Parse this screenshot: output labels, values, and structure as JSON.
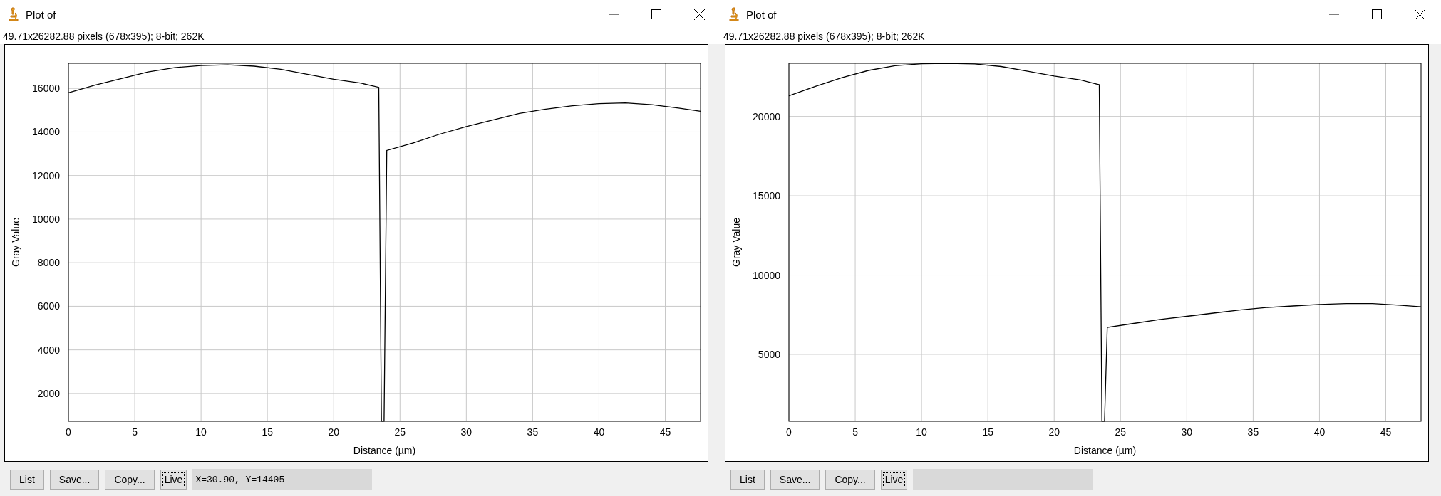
{
  "windows": [
    {
      "title": "Plot of",
      "subtitle": "49.71x26282.88 pixels (678x395); 8-bit; 262K",
      "chart_data": {
        "type": "line",
        "xlabel": "Distance (µm)",
        "ylabel": "Gray Value",
        "x": [
          0,
          2,
          4,
          6,
          8,
          10,
          12,
          14,
          16,
          18,
          20,
          22,
          23.4,
          23.6,
          23.8,
          24,
          26,
          28,
          30,
          32,
          34,
          36,
          38,
          40,
          42,
          44,
          46,
          47.66
        ],
        "series": [
          {
            "color": "#000000",
            "values": [
              15800,
              16150,
              16450,
              16750,
              16950,
              17050,
              17080,
              17020,
              16880,
              16650,
              16420,
              16250,
              16050,
              730,
              730,
              13150,
              13500,
              13900,
              14250,
              14550,
              14850,
              15050,
              15200,
              15300,
              15330,
              15250,
              15100,
              14950
            ]
          }
        ],
        "grid": true,
        "xlim": [
          0,
          47.66
        ],
        "ylim": [
          723,
          17150
        ],
        "xticks": [
          0,
          5,
          10,
          15,
          20,
          25,
          30,
          35,
          40,
          45
        ],
        "yticks": [
          2000,
          4000,
          6000,
          8000,
          10000,
          12000,
          14000,
          16000
        ]
      },
      "buttons": [
        {
          "label": "List",
          "focused": false
        },
        {
          "label": "Save...",
          "focused": false
        },
        {
          "label": "Copy...",
          "focused": false
        },
        {
          "label": "Live",
          "focused": true
        }
      ],
      "status": "X=30.90, Y=14405"
    },
    {
      "title": "Plot of",
      "subtitle": "49.71x26282.88 pixels (678x395); 8-bit; 262K",
      "chart_data": {
        "type": "line",
        "xlabel": "Distance (µm)",
        "ylabel": "Gray Value",
        "x": [
          0,
          2,
          4,
          6,
          8,
          10,
          12,
          14,
          16,
          18,
          20,
          22,
          23.4,
          23.6,
          23.8,
          24,
          26,
          28,
          30,
          32,
          34,
          36,
          38,
          40,
          42,
          44,
          46,
          47.66
        ],
        "series": [
          {
            "color": "#000000",
            "values": [
              21300,
              21900,
              22450,
              22900,
              23200,
              23320,
              23340,
              23310,
              23150,
              22850,
              22550,
              22300,
              22000,
              790,
              790,
              6700,
              6950,
              7200,
              7400,
              7600,
              7800,
              7950,
              8050,
              8150,
              8200,
              8200,
              8100,
              8000
            ]
          }
        ],
        "grid": true,
        "xlim": [
          0,
          47.66
        ],
        "ylim": [
          780,
          23350
        ],
        "xticks": [
          0,
          5,
          10,
          15,
          20,
          25,
          30,
          35,
          40,
          45
        ],
        "yticks": [
          5000,
          10000,
          15000,
          20000
        ]
      },
      "buttons": [
        {
          "label": "List",
          "focused": false
        },
        {
          "label": "Save...",
          "focused": false
        },
        {
          "label": "Copy...",
          "focused": false
        },
        {
          "label": "Live",
          "focused": true
        }
      ]
    }
  ]
}
